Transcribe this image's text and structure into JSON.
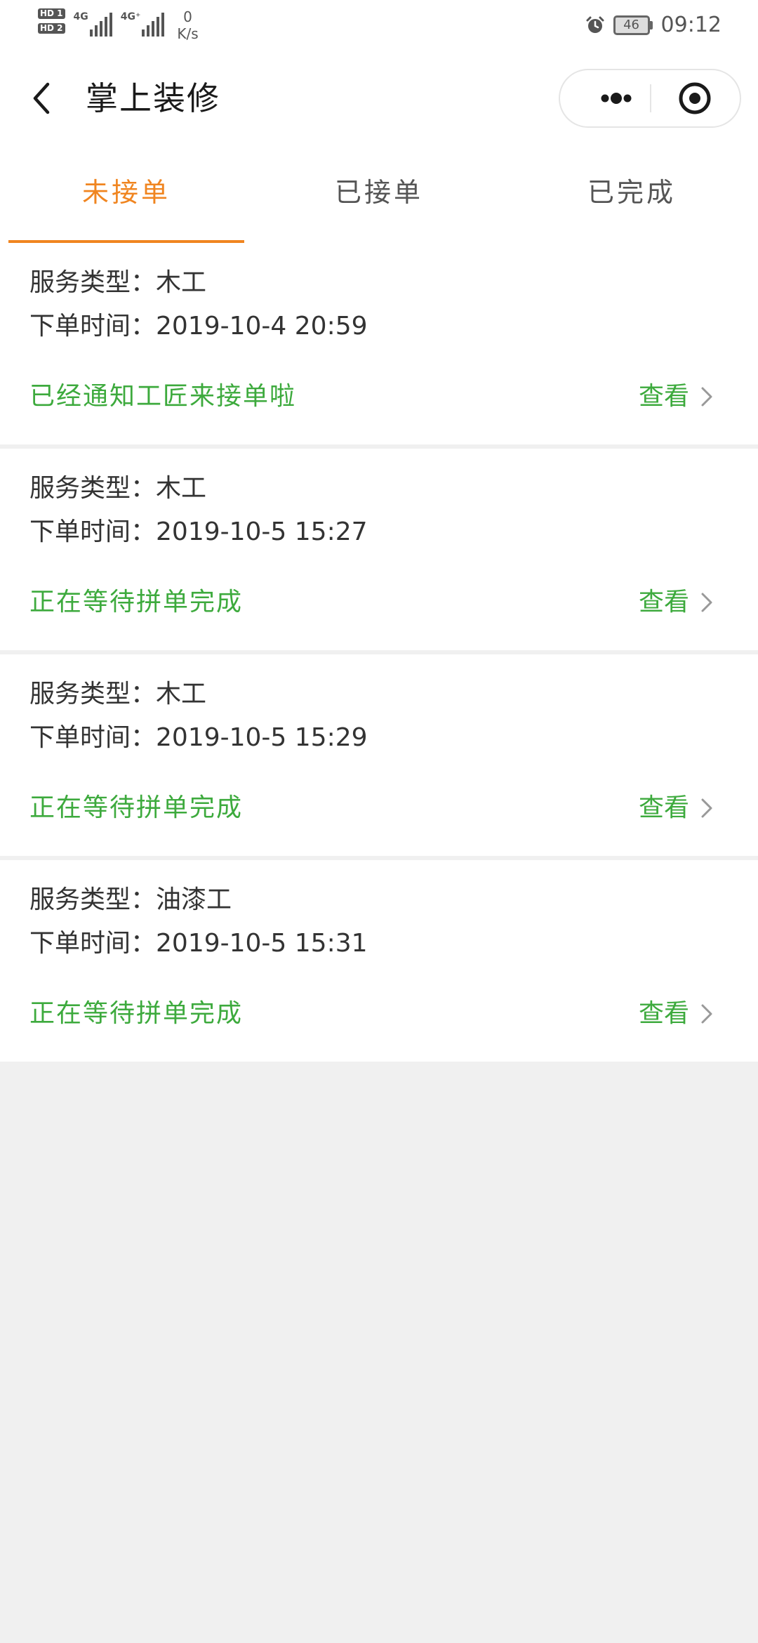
{
  "status_bar": {
    "network_1": "4G",
    "network_2": "4G⁺",
    "speed_value": "0",
    "speed_unit": "K/s",
    "battery": "46",
    "time": "09:12"
  },
  "nav": {
    "title": "掌上装修"
  },
  "tabs": [
    {
      "label": "未接单",
      "active": true
    },
    {
      "label": "已接单",
      "active": false
    },
    {
      "label": "已完成",
      "active": false
    }
  ],
  "orders": [
    {
      "type_label": "服务类型：",
      "type": "木工",
      "time_label": "下单时间：",
      "time": "2019-10-4 20:59",
      "status": "已经通知工匠来接单啦",
      "view": "查看"
    },
    {
      "type_label": "服务类型：",
      "type": "木工",
      "time_label": "下单时间：",
      "time": "2019-10-5 15:27",
      "status": "正在等待拼单完成",
      "view": "查看"
    },
    {
      "type_label": "服务类型：",
      "type": "木工",
      "time_label": "下单时间：",
      "time": "2019-10-5 15:29",
      "status": "正在等待拼单完成",
      "view": "查看"
    },
    {
      "type_label": "服务类型：",
      "type": "油漆工",
      "time_label": "下单时间：",
      "time": "2019-10-5 15:31",
      "status": "正在等待拼单完成",
      "view": "查看"
    }
  ],
  "colors": {
    "accent": "#f08520",
    "status_green": "#3daa3d",
    "background": "#f0f0f0"
  }
}
